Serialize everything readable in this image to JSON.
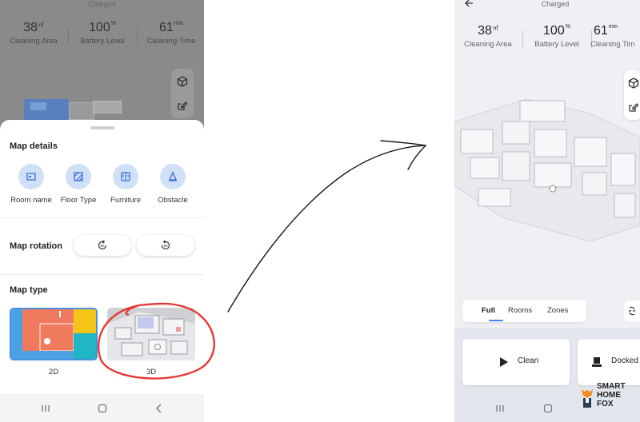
{
  "status": {
    "charged": "Charged"
  },
  "stats": [
    {
      "value": "38",
      "unit": "㎡",
      "label": "Cleaning Area"
    },
    {
      "value": "100",
      "unit": "%",
      "label": "Battery Level"
    },
    {
      "value": "61",
      "unit": "min",
      "label": "Cleaning Time"
    }
  ],
  "right_stats": [
    {
      "value": "38",
      "unit": "㎡",
      "label": "Cleaning Area"
    },
    {
      "value": "100",
      "unit": "%",
      "label": "Battery Level"
    },
    {
      "value": "61",
      "unit": "min",
      "label": "Cleaning Tim"
    }
  ],
  "map_details": {
    "title": "Map details",
    "items": [
      {
        "label": "Room name",
        "icon": "room-name-icon"
      },
      {
        "label": "Floor Type",
        "icon": "floor-type-icon"
      },
      {
        "label": "Furniture",
        "icon": "furniture-icon"
      },
      {
        "label": "Obstacle",
        "icon": "obstacle-icon"
      }
    ]
  },
  "map_rotation": {
    "title": "Map rotation",
    "ccw_label": "90",
    "cw_label": "90"
  },
  "map_type": {
    "title": "Map type",
    "options": [
      {
        "label": "2D",
        "selected": true
      },
      {
        "label": "3D",
        "selected": false
      }
    ]
  },
  "tabs": [
    {
      "label": "Full",
      "active": true
    },
    {
      "label": "Rooms",
      "active": false
    },
    {
      "label": "Zones",
      "active": false
    }
  ],
  "actions": {
    "clean_label": "Clean",
    "docked_label": "Docked"
  },
  "brand": {
    "line1": "SMART",
    "line2": "HOME",
    "line3": "FOX"
  },
  "colors": {
    "accent": "#3b82f6",
    "annotation": "#e53935",
    "selection": "#4a90e2"
  }
}
